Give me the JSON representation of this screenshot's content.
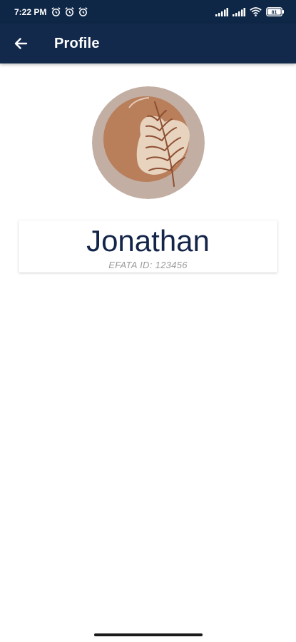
{
  "status_bar": {
    "time": "7:22 PM",
    "battery": "81",
    "icons": [
      "alarm-icon",
      "alarm-icon",
      "alarm-icon",
      "signal-icon",
      "signal-icon",
      "wifi-icon",
      "battery-icon"
    ]
  },
  "app_bar": {
    "title": "Profile",
    "back_icon": "arrow-left-icon"
  },
  "profile": {
    "name": "Jonathan",
    "id_label": "EFATA ID: 123456"
  },
  "colors": {
    "status_bar": "#0f2747",
    "app_bar": "#13294b",
    "name_text": "#14254a",
    "avatar_outer": "#c2aea3",
    "avatar_inner": "#b97e5a",
    "avatar_leaf_bg": "#e8d3be",
    "avatar_leaf": "#8c4f32"
  }
}
